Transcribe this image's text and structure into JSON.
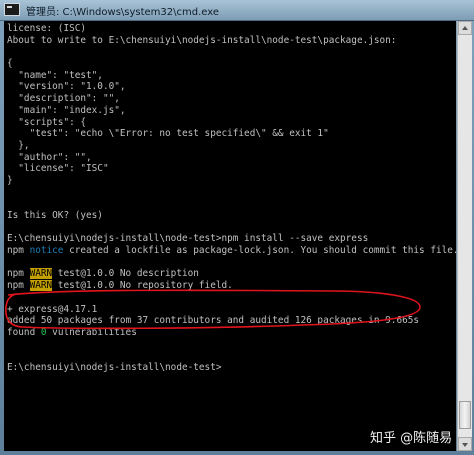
{
  "window": {
    "title": "管理员: C:\\Windows\\system32\\cmd.exe"
  },
  "console": {
    "lines": [
      [
        {
          "t": "license: (ISC)"
        }
      ],
      [
        {
          "t": "About to write to E:\\chensuiyi\\nodejs-install\\node-test\\package.json:"
        }
      ],
      [
        {
          "t": ""
        }
      ],
      [
        {
          "t": "{"
        }
      ],
      [
        {
          "t": "  \"name\": \"test\","
        }
      ],
      [
        {
          "t": "  \"version\": \"1.0.0\","
        }
      ],
      [
        {
          "t": "  \"description\": \"\","
        }
      ],
      [
        {
          "t": "  \"main\": \"index.js\","
        }
      ],
      [
        {
          "t": "  \"scripts\": {"
        }
      ],
      [
        {
          "t": "    \"test\": \"echo \\\"Error: no test specified\\\" && exit 1\""
        }
      ],
      [
        {
          "t": "  },"
        }
      ],
      [
        {
          "t": "  \"author\": \"\","
        }
      ],
      [
        {
          "t": "  \"license\": \"ISC\""
        }
      ],
      [
        {
          "t": "}"
        }
      ],
      [
        {
          "t": ""
        }
      ],
      [
        {
          "t": ""
        }
      ],
      [
        {
          "t": "Is this OK? (yes)"
        }
      ],
      [
        {
          "t": ""
        }
      ],
      [
        {
          "t": "E:\\chensuiyi\\nodejs-install\\node-test>npm install --save express"
        }
      ],
      [
        {
          "t": "npm "
        },
        {
          "t": "notice",
          "s": "npm-notice"
        },
        {
          "t": " created a lockfile as package-lock.json. You should commit this file."
        }
      ],
      [
        {
          "t": ""
        }
      ],
      [
        {
          "t": "npm "
        },
        {
          "t": "WARN",
          "s": "npm-warn"
        },
        {
          "t": " test@1.0.0 No description"
        }
      ],
      [
        {
          "t": "npm "
        },
        {
          "t": "WARN",
          "s": "npm-warn"
        },
        {
          "t": " test@1.0.0 No repository field."
        }
      ],
      [
        {
          "t": ""
        }
      ],
      [
        {
          "t": "+ express@4.17.1"
        }
      ],
      [
        {
          "t": "added 50 packages from 37 contributors and audited 126 packages in 9.665s"
        }
      ],
      [
        {
          "t": "found "
        },
        {
          "t": "0",
          "s": "green"
        },
        {
          "t": " vulnerabilities"
        }
      ],
      [
        {
          "t": ""
        }
      ],
      [
        {
          "t": ""
        }
      ],
      [
        {
          "t": "E:\\chensuiyi\\nodejs-install\\node-test>"
        }
      ]
    ]
  },
  "annotation": {
    "color": "#e0141c"
  },
  "watermark": {
    "text": "知乎 @陈随易"
  },
  "colors": {
    "console_bg": "#000000",
    "console_text": "#c0c0c0",
    "warn_bg": "#c4a000",
    "notice": "#1e7fb5",
    "success": "#23c552"
  }
}
